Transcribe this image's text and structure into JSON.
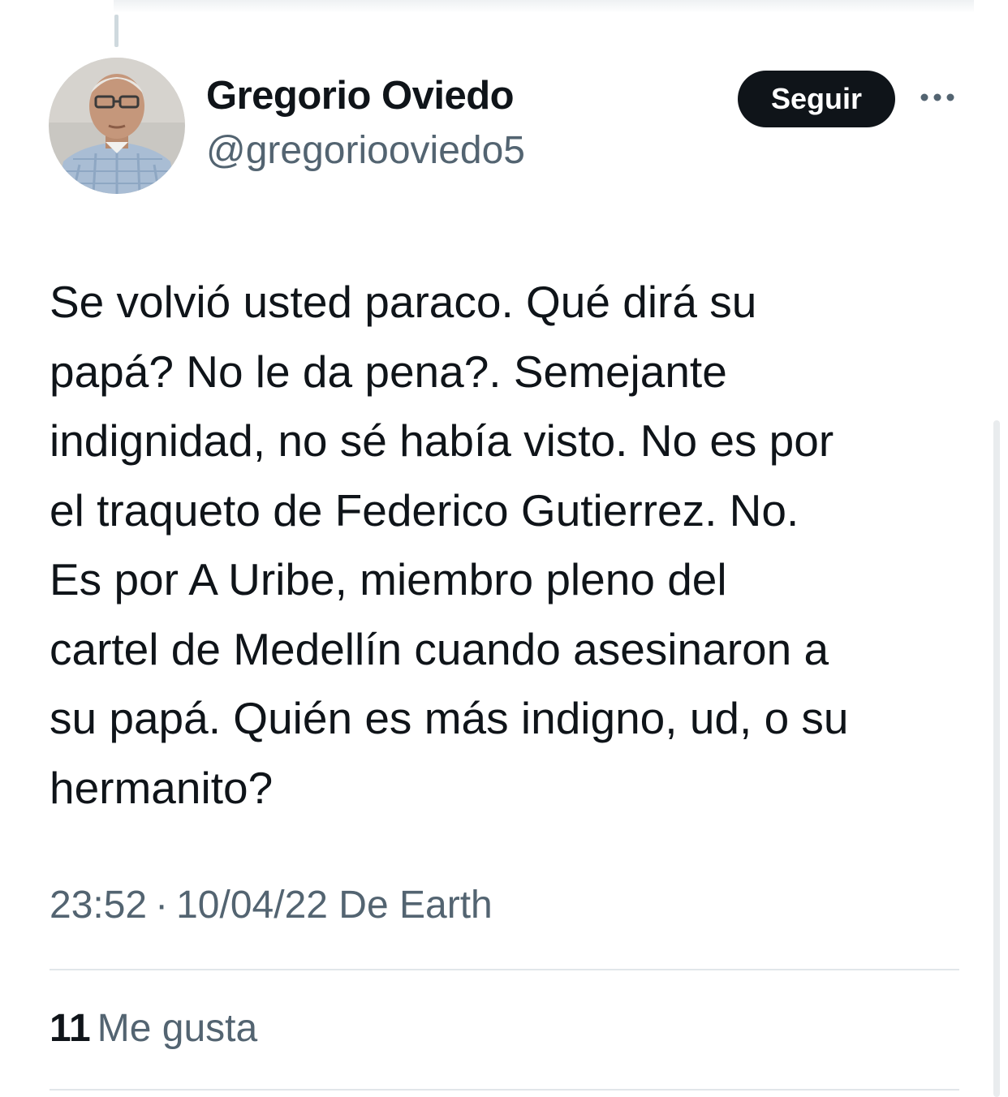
{
  "user": {
    "display_name": "Gregorio Oviedo",
    "handle": "@gregoriooviedo5"
  },
  "follow_button_label": "Seguir",
  "tweet": {
    "text": "Se volvió usted paraco. Qué dirá su\npapá? No le da pena?. Semejante\nindignidad, no sé había visto. No es por\nel traqueto de Federico Gutierrez. No.\nEs por A Uribe, miembro pleno del\ncartel de Medellín cuando asesinaron a\nsu papá. Quién es más indigno, ud, o su\nhermanito?",
    "time": "23:52",
    "separator": "·",
    "date": "10/04/22",
    "source": "De Earth"
  },
  "stats": {
    "likes_count": "11",
    "likes_label": "Me gusta"
  },
  "icons": {
    "more": "more-horizontal-icon"
  },
  "colors": {
    "text_primary": "#0f1419",
    "text_secondary": "#536471",
    "button_bg": "#0f1419",
    "divider": "#e1e6ea"
  }
}
